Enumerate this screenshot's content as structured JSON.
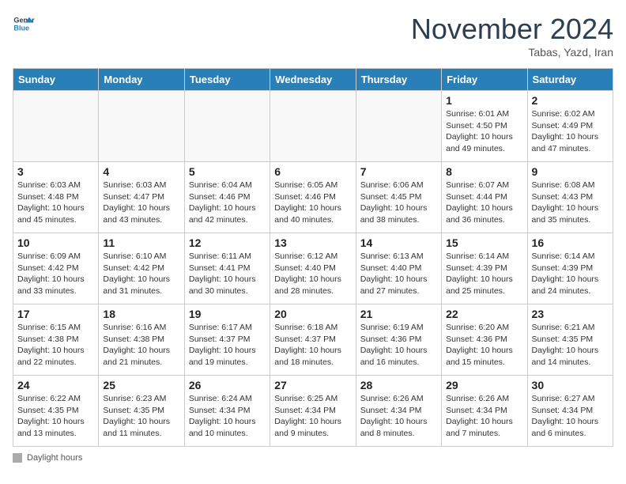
{
  "header": {
    "logo_general": "General",
    "logo_blue": "Blue",
    "month_title": "November 2024",
    "subtitle": "Tabas, Yazd, Iran"
  },
  "days_of_week": [
    "Sunday",
    "Monday",
    "Tuesday",
    "Wednesday",
    "Thursday",
    "Friday",
    "Saturday"
  ],
  "footer": {
    "label": "Daylight hours"
  },
  "weeks": [
    [
      {
        "day": "",
        "info": ""
      },
      {
        "day": "",
        "info": ""
      },
      {
        "day": "",
        "info": ""
      },
      {
        "day": "",
        "info": ""
      },
      {
        "day": "",
        "info": ""
      },
      {
        "day": "1",
        "info": "Sunrise: 6:01 AM\nSunset: 4:50 PM\nDaylight: 10 hours and 49 minutes."
      },
      {
        "day": "2",
        "info": "Sunrise: 6:02 AM\nSunset: 4:49 PM\nDaylight: 10 hours and 47 minutes."
      }
    ],
    [
      {
        "day": "3",
        "info": "Sunrise: 6:03 AM\nSunset: 4:48 PM\nDaylight: 10 hours and 45 minutes."
      },
      {
        "day": "4",
        "info": "Sunrise: 6:03 AM\nSunset: 4:47 PM\nDaylight: 10 hours and 43 minutes."
      },
      {
        "day": "5",
        "info": "Sunrise: 6:04 AM\nSunset: 4:46 PM\nDaylight: 10 hours and 42 minutes."
      },
      {
        "day": "6",
        "info": "Sunrise: 6:05 AM\nSunset: 4:46 PM\nDaylight: 10 hours and 40 minutes."
      },
      {
        "day": "7",
        "info": "Sunrise: 6:06 AM\nSunset: 4:45 PM\nDaylight: 10 hours and 38 minutes."
      },
      {
        "day": "8",
        "info": "Sunrise: 6:07 AM\nSunset: 4:44 PM\nDaylight: 10 hours and 36 minutes."
      },
      {
        "day": "9",
        "info": "Sunrise: 6:08 AM\nSunset: 4:43 PM\nDaylight: 10 hours and 35 minutes."
      }
    ],
    [
      {
        "day": "10",
        "info": "Sunrise: 6:09 AM\nSunset: 4:42 PM\nDaylight: 10 hours and 33 minutes."
      },
      {
        "day": "11",
        "info": "Sunrise: 6:10 AM\nSunset: 4:42 PM\nDaylight: 10 hours and 31 minutes."
      },
      {
        "day": "12",
        "info": "Sunrise: 6:11 AM\nSunset: 4:41 PM\nDaylight: 10 hours and 30 minutes."
      },
      {
        "day": "13",
        "info": "Sunrise: 6:12 AM\nSunset: 4:40 PM\nDaylight: 10 hours and 28 minutes."
      },
      {
        "day": "14",
        "info": "Sunrise: 6:13 AM\nSunset: 4:40 PM\nDaylight: 10 hours and 27 minutes."
      },
      {
        "day": "15",
        "info": "Sunrise: 6:14 AM\nSunset: 4:39 PM\nDaylight: 10 hours and 25 minutes."
      },
      {
        "day": "16",
        "info": "Sunrise: 6:14 AM\nSunset: 4:39 PM\nDaylight: 10 hours and 24 minutes."
      }
    ],
    [
      {
        "day": "17",
        "info": "Sunrise: 6:15 AM\nSunset: 4:38 PM\nDaylight: 10 hours and 22 minutes."
      },
      {
        "day": "18",
        "info": "Sunrise: 6:16 AM\nSunset: 4:38 PM\nDaylight: 10 hours and 21 minutes."
      },
      {
        "day": "19",
        "info": "Sunrise: 6:17 AM\nSunset: 4:37 PM\nDaylight: 10 hours and 19 minutes."
      },
      {
        "day": "20",
        "info": "Sunrise: 6:18 AM\nSunset: 4:37 PM\nDaylight: 10 hours and 18 minutes."
      },
      {
        "day": "21",
        "info": "Sunrise: 6:19 AM\nSunset: 4:36 PM\nDaylight: 10 hours and 16 minutes."
      },
      {
        "day": "22",
        "info": "Sunrise: 6:20 AM\nSunset: 4:36 PM\nDaylight: 10 hours and 15 minutes."
      },
      {
        "day": "23",
        "info": "Sunrise: 6:21 AM\nSunset: 4:35 PM\nDaylight: 10 hours and 14 minutes."
      }
    ],
    [
      {
        "day": "24",
        "info": "Sunrise: 6:22 AM\nSunset: 4:35 PM\nDaylight: 10 hours and 13 minutes."
      },
      {
        "day": "25",
        "info": "Sunrise: 6:23 AM\nSunset: 4:35 PM\nDaylight: 10 hours and 11 minutes."
      },
      {
        "day": "26",
        "info": "Sunrise: 6:24 AM\nSunset: 4:34 PM\nDaylight: 10 hours and 10 minutes."
      },
      {
        "day": "27",
        "info": "Sunrise: 6:25 AM\nSunset: 4:34 PM\nDaylight: 10 hours and 9 minutes."
      },
      {
        "day": "28",
        "info": "Sunrise: 6:26 AM\nSunset: 4:34 PM\nDaylight: 10 hours and 8 minutes."
      },
      {
        "day": "29",
        "info": "Sunrise: 6:26 AM\nSunset: 4:34 PM\nDaylight: 10 hours and 7 minutes."
      },
      {
        "day": "30",
        "info": "Sunrise: 6:27 AM\nSunset: 4:34 PM\nDaylight: 10 hours and 6 minutes."
      }
    ]
  ]
}
